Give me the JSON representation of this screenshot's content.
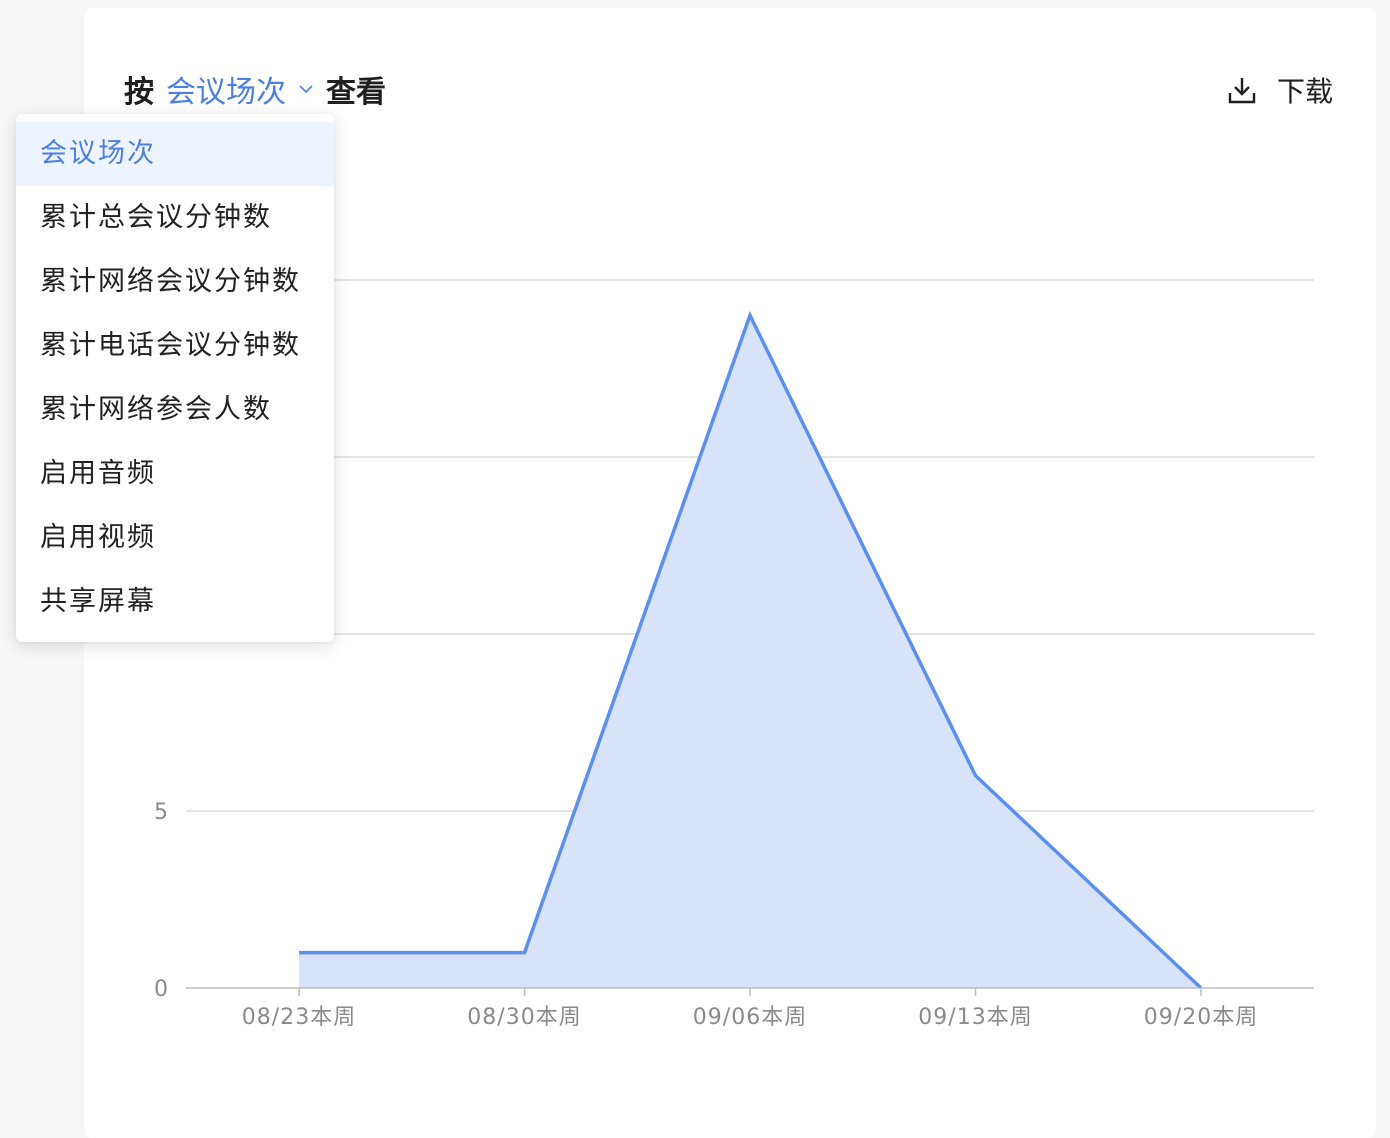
{
  "header": {
    "prefix": "按",
    "selected_metric": "会议场次",
    "suffix": "查看",
    "download_label": "下载"
  },
  "dropdown": {
    "selected_index": 0,
    "options": [
      "会议场次",
      "累计总会议分钟数",
      "累计网络会议分钟数",
      "累计电话会议分钟数",
      "累计网络参会人数",
      "启用音频",
      "启用视频",
      "共享屏幕"
    ]
  },
  "colors": {
    "accent": "#4b7fe0",
    "line": "#5b8ff0",
    "area_fill": "#d8e2f8",
    "grid": "#dcdcdc",
    "selected_bg": "#eef4ff"
  },
  "chart_data": {
    "type": "area",
    "categories": [
      "08/23本周",
      "08/30本周",
      "09/06本周",
      "09/13本周",
      "09/20本周"
    ],
    "series": [
      {
        "values": [
          1,
          1,
          19,
          6,
          0
        ]
      }
    ],
    "y_ticks": [
      0,
      5
    ],
    "ylim": [
      0,
      20
    ],
    "grid": true
  }
}
